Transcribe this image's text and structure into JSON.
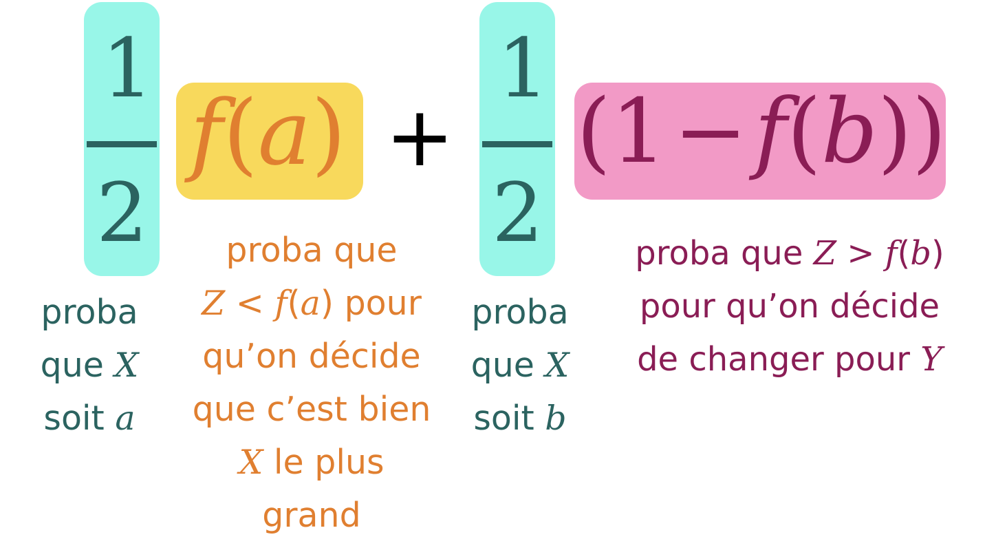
{
  "formula": {
    "half_1": {
      "numerator": "1",
      "denominator": "2"
    },
    "term_a": {
      "f": "f",
      "open": "(",
      "var": "a",
      "close": ")"
    },
    "plus": "+",
    "half_2": {
      "numerator": "1",
      "denominator": "2"
    },
    "term_b": {
      "open": "(",
      "one": "1",
      "minus": "−",
      "f": "f",
      "open2": "(",
      "var": "b",
      "close": "))"
    }
  },
  "labels": {
    "half_1": {
      "line1": "proba",
      "line2_text": "que ",
      "line2_var": "X",
      "line3_text": "soit ",
      "line3_var": "a"
    },
    "term_a": {
      "line1": "proba que",
      "line2_Z": "Z",
      "line2_lt": " < ",
      "line2_f": "f",
      "line2_open": "(",
      "line2_var": "a",
      "line2_close": ")",
      "line2_text": " pour",
      "line3": "qu’on décide",
      "line4": "que c’est bien",
      "line5_var": "X",
      "line5_text": " le plus",
      "line6": "grand"
    },
    "half_2": {
      "line1": "proba",
      "line2_text": "que ",
      "line2_var": "X",
      "line3_text": "soit ",
      "line3_var": "b"
    },
    "term_b": {
      "line1_text": "proba que ",
      "line1_Z": "Z",
      "line1_gt": " > ",
      "line1_f": "f",
      "line1_open": "(",
      "line1_var": "b",
      "line1_close": ")",
      "line2": "pour qu’on décide",
      "line3_text": "de changer pour ",
      "line3_var": "Y"
    }
  },
  "colors": {
    "teal_box": "#98f6e8",
    "teal_text": "#2b6360",
    "yellow_box": "#f8d95c",
    "orange_text": "#e07f30",
    "pink_box": "#f29ac6",
    "plum_text": "#8a1d55",
    "black": "#000000"
  }
}
